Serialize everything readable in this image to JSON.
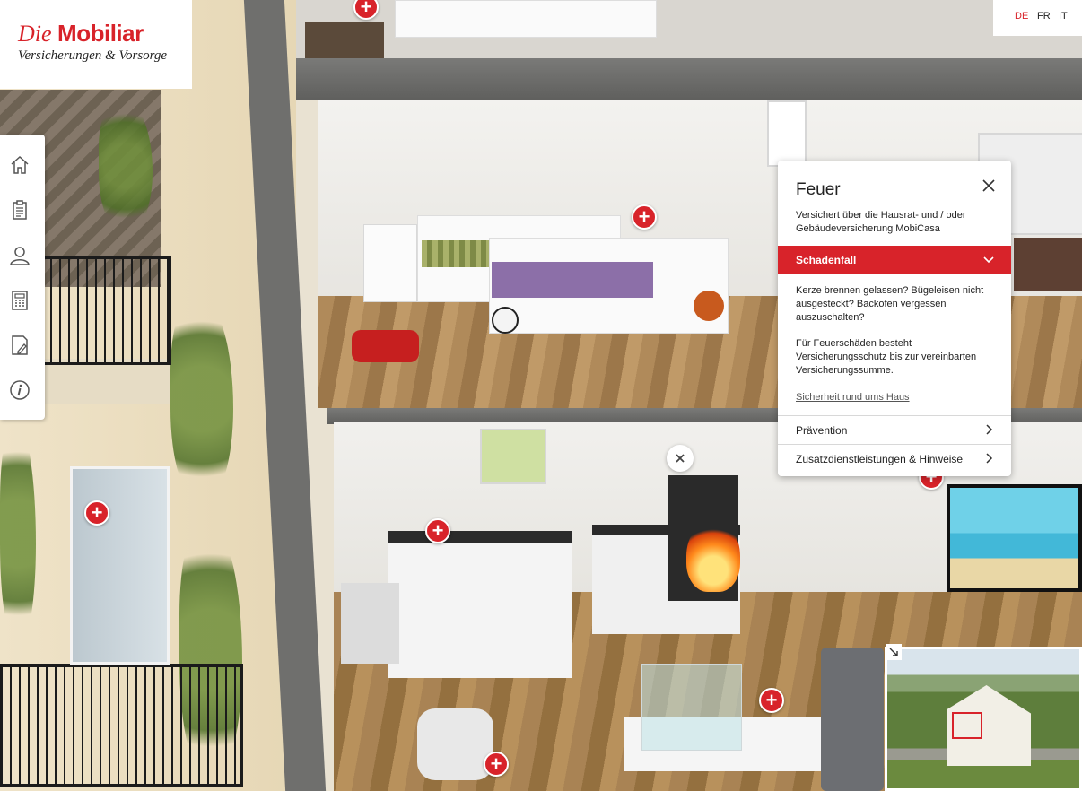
{
  "brand": {
    "name_italic": "Die",
    "name_bold": "Mobiliar",
    "tagline": "Versicherungen & Vorsorge",
    "color": "#d8232a"
  },
  "languages": [
    {
      "code": "DE",
      "active": true
    },
    {
      "code": "FR",
      "active": false
    },
    {
      "code": "IT",
      "active": false
    }
  ],
  "side_nav": [
    {
      "icon": "home-icon"
    },
    {
      "icon": "clipboard-icon"
    },
    {
      "icon": "person-icon"
    },
    {
      "icon": "calculator-icon"
    },
    {
      "icon": "document-edit-icon"
    },
    {
      "icon": "info-icon"
    }
  ],
  "panel": {
    "title": "Feuer",
    "subtitle": "Versichert über die Hausrat- und / oder Gebäudeversicherung MobiCasa",
    "accordion": {
      "expanded_label": "Schadenfall",
      "paragraph_1": "Kerze brennen gelassen? Bügeleisen nicht ausgesteckt? Backofen vergessen auszuschalten?",
      "paragraph_2": "Für Feuerschäden besteht Versicherungsschutz bis zur vereinbarten Versicherungssumme.",
      "link": "Sicherheit rund ums Haus",
      "collapsed": [
        {
          "label": "Prävention"
        },
        {
          "label": "Zusatzdienstleistungen & Hinweise"
        }
      ]
    }
  },
  "hotspots": [
    {
      "symbol": "+"
    },
    {
      "symbol": "+"
    },
    {
      "symbol": "+"
    },
    {
      "symbol": "+"
    },
    {
      "symbol": "+"
    },
    {
      "symbol": "+"
    },
    {
      "symbol": "+"
    }
  ],
  "minimap": {
    "icon": "expand-arrow-icon"
  }
}
